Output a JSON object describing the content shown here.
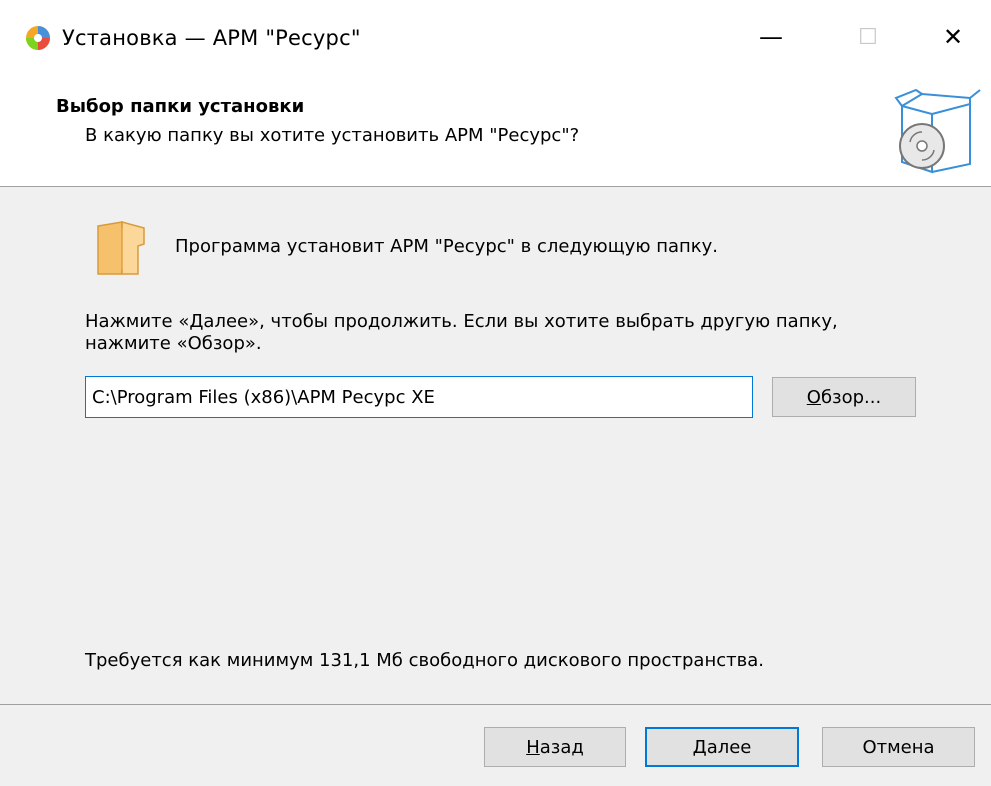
{
  "window": {
    "title": "Установка — АРМ \"Ресурс\"",
    "controls": {
      "minimize": "—",
      "maximize": "☐",
      "close": "✕"
    }
  },
  "header": {
    "title": "Выбор папки установки",
    "subtitle": "В какую папку вы хотите установить АРМ \"Ресурс\"?"
  },
  "body": {
    "destination_text": "Программа установит АРМ \"Ресурс\" в следующую папку.",
    "instructions_line1": "Нажмите «Далее», чтобы продолжить. Если вы хотите выбрать другую папку,",
    "instructions_line2": "нажмите «Обзор».",
    "path_value": "C:\\Program Files (x86)\\АРМ Ресурс XE",
    "browse": {
      "accel": "О",
      "rest": "бзор..."
    },
    "space_required": "Требуется как минимум 131,1 Мб свободного дискового пространства."
  },
  "footer": {
    "back": {
      "accel": "Н",
      "rest": "азад"
    },
    "next": {
      "accel": "Д",
      "rest": "алее"
    },
    "cancel": "Отмена"
  },
  "icons": {
    "app": "app-icon",
    "setup": "setup-box-icon",
    "folder": "folder-icon"
  },
  "colors": {
    "accent": "#0078d7",
    "header_bg": "#ffffff",
    "body_bg": "#f0f0f0"
  }
}
